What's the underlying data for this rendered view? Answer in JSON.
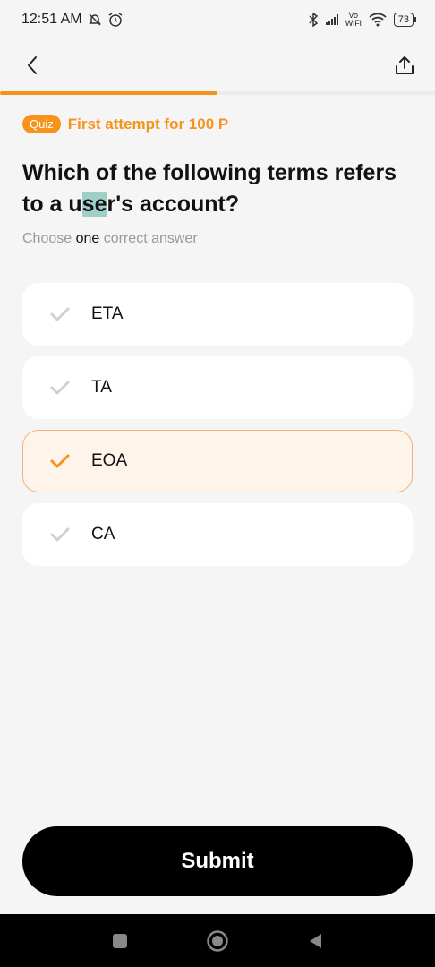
{
  "status": {
    "time": "12:51 AM",
    "vo": "Vo",
    "wifi_label": "WiFi",
    "battery": "73"
  },
  "progress": {
    "fraction": 0.5
  },
  "quiz": {
    "badge": "Quiz",
    "attempt": "First attempt for 100 P"
  },
  "question": {
    "part1": "Which of the following terms refers to a u",
    "highlight": "se",
    "part2": "r's account?"
  },
  "hint": {
    "before": "Choose ",
    "emph": "one",
    "after": " correct answer"
  },
  "options": [
    {
      "label": "ETA",
      "selected": false
    },
    {
      "label": "TA",
      "selected": false
    },
    {
      "label": "EOA",
      "selected": true
    },
    {
      "label": "CA",
      "selected": false
    }
  ],
  "submit_label": "Submit",
  "colors": {
    "accent": "#f7931a",
    "selected_bg": "#fff4ea",
    "check_inactive": "#d0d0d0"
  },
  "icons": {
    "back": "back-arrow-icon",
    "share": "share-icon",
    "check": "checkmark-icon"
  }
}
